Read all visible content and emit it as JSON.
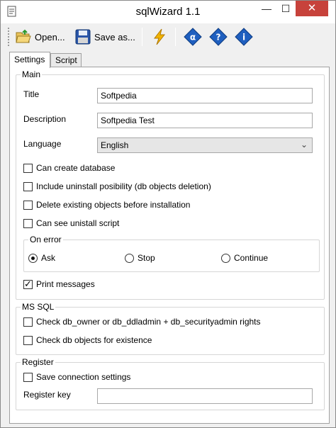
{
  "window": {
    "title": "sqlWizard 1.1",
    "minimize_glyph": "—",
    "maximize_glyph": "☐",
    "close_glyph": "✕"
  },
  "toolbar": {
    "open_label": "Open...",
    "save_label": "Save as...",
    "icons": [
      "folder-open-icon",
      "floppy-disk-icon",
      "lightning-icon",
      "alpha-icon",
      "help-icon",
      "info-icon"
    ]
  },
  "tabs": [
    {
      "label": "Settings",
      "active": true
    },
    {
      "label": "Script",
      "active": false
    }
  ],
  "main": {
    "group_title": "Main",
    "title_label": "Title",
    "title_value": "Softpedia",
    "description_label": "Description",
    "description_value": "Softpedia Test",
    "language_label": "Language",
    "language_value": "English",
    "checks": [
      {
        "label": "Can create database",
        "checked": false
      },
      {
        "label": "Include uninstall posibility (db objects deletion)",
        "checked": false
      },
      {
        "label": "Delete existing objects before installation",
        "checked": false
      },
      {
        "label": "Can see unistall script",
        "checked": false
      }
    ],
    "on_error": {
      "title": "On error",
      "options": [
        {
          "label": "Ask",
          "selected": true
        },
        {
          "label": "Stop",
          "selected": false
        },
        {
          "label": "Continue",
          "selected": false
        }
      ]
    },
    "print_messages": {
      "label": "Print messages",
      "checked": true
    }
  },
  "mssql": {
    "group_title": "MS SQL",
    "checks": [
      {
        "label": "Check db_owner or db_ddladmin + db_securityadmin rights",
        "checked": false
      },
      {
        "label": "Check db objects for existence",
        "checked": false
      }
    ]
  },
  "register": {
    "group_title": "Register",
    "save_connection": {
      "label": "Save connection settings",
      "checked": false
    },
    "key_label": "Register key",
    "key_value": ""
  },
  "colors": {
    "close_button": "#c7423b",
    "icon_blue": "#1f5fbf",
    "lightning": "#f2b400"
  }
}
